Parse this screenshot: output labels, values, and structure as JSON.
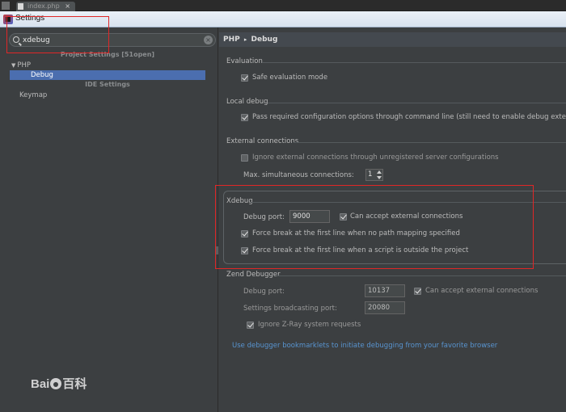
{
  "editor_tab": {
    "label": "index.php",
    "close": "×"
  },
  "window": {
    "title": "Settings"
  },
  "search": {
    "value": "xdebug",
    "clear_icon": "×"
  },
  "left_panel": {
    "project_settings_header": "Project Settings [51open]",
    "ide_settings_header": "IDE Settings",
    "tree": [
      {
        "label": "PHP",
        "expanded": true
      },
      {
        "label": "Debug",
        "selected": true
      },
      {
        "label": "Keymap"
      }
    ],
    "php_arrow": "▼"
  },
  "breadcrumb": {
    "parent": "PHP",
    "separator": "▸",
    "current": "Debug"
  },
  "evaluation": {
    "title": "Evaluation",
    "safe_mode": {
      "label": "Safe evaluation mode",
      "checked": true
    }
  },
  "local_debug": {
    "title": "Local debug",
    "pass_config": {
      "label": "Pass required configuration options through command line (still need to enable debug extens",
      "checked": true
    }
  },
  "external": {
    "title": "External connections",
    "ignore_unregistered": {
      "label": "Ignore external connections through unregistered server configurations",
      "checked": false
    },
    "max_connections_label": "Max. simultaneous connections:",
    "max_connections_value": "1"
  },
  "xdebug": {
    "title": "Xdebug",
    "debug_port_label": "Debug port:",
    "debug_port_value": "9000",
    "accept_external": {
      "label": "Can accept external connections",
      "checked": true
    },
    "force_break_no_mapping": {
      "label": "Force break at the first line when no path mapping specified",
      "checked": true
    },
    "force_break_outside": {
      "label": "Force break at the first line when a script is outside the project",
      "checked": true
    }
  },
  "zend": {
    "title": "Zend Debugger",
    "debug_port_label": "Debug port:",
    "debug_port_value": "10137",
    "accept_external": {
      "label": "Can accept external connections",
      "checked": true
    },
    "broadcast_label": "Settings broadcasting port:",
    "broadcast_value": "20080",
    "ignore_zray": {
      "label": "Ignore Z-Ray system requests",
      "checked": true
    }
  },
  "bookmarklets_link": "Use debugger bookmarklets to initiate debugging from your favorite browser",
  "watermark": {
    "text_left": "Bai",
    "text_right": "百科"
  },
  "colors": {
    "selection": "#4b6eaf",
    "annotation": "#e02727",
    "link": "#5894d0",
    "background": "#3c3f41"
  }
}
